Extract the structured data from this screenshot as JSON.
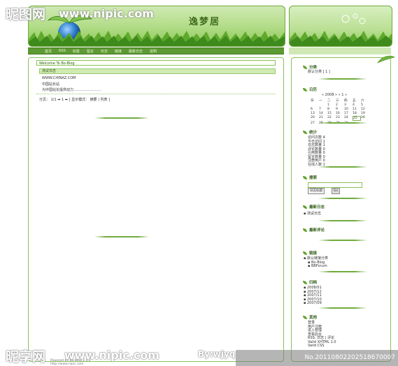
{
  "watermark": {
    "top_left": "昵图网",
    "top_url": "www.nipic.com",
    "bottom_left": "昵享网",
    "bottom_url": "www.nipic.com",
    "bottom_author": "By:wjyq",
    "id_text": "No.20110802202518670007"
  },
  "header": {
    "title": "逸梦居"
  },
  "nav": {
    "items": [
      "首页",
      "RSS",
      "标签",
      "留言",
      "日志",
      "链接",
      "最新日志",
      "说明"
    ]
  },
  "main": {
    "welcome": "Welcome To Bo-Blog",
    "post": {
      "title": "测试日志",
      "lines": [
        "WWW.CHINAZ.COM",
        "中国站长站",
        "为中国站长提供动力........................."
      ]
    },
    "pager": "分页： 1/1 ➡ 1 ➡ [ 显示模式： 摘要 | 列表 ]"
  },
  "sidebar": {
    "category": {
      "title": "分类",
      "items": [
        "默认分类 [ 1 ]"
      ]
    },
    "calendar": {
      "title": "日历",
      "header": "« 2008 » « 1 »",
      "weekdays": [
        "日",
        "一",
        "二",
        "三",
        "四",
        "五",
        "六"
      ],
      "days": [
        "",
        "",
        "1",
        "2",
        "3",
        "4",
        "5",
        "6",
        "7",
        "8",
        "9",
        "10",
        "11",
        "12",
        "13",
        "14",
        "15",
        "16",
        "17",
        "18",
        "19",
        "20",
        "21",
        "22",
        "23",
        "24",
        "25",
        "26",
        "27",
        "28",
        "29",
        "30",
        "31",
        "",
        ""
      ],
      "today": "25"
    },
    "stats": {
      "title": "统计",
      "items": [
        "访问次数 4",
        "今日访问 1",
        "日志数量 1",
        "评论数量 0",
        "引用数量 0",
        "留言数量 0",
        "注册用户 0",
        "在线人数 1"
      ]
    },
    "search": {
      "title": "搜索",
      "select_value": "日志标题",
      "go": "Go"
    },
    "latest_posts": {
      "title": "最新日志",
      "items": [
        "测试日志"
      ]
    },
    "latest_comments": {
      "title": "最新评论"
    },
    "links": {
      "title": "链接",
      "items": [
        "默认链接分类",
        "Bo-Blog",
        "BBForum"
      ]
    },
    "archive": {
      "title": "归档",
      "items": [
        "2008/01",
        "2007/12",
        "2007/11",
        "2007/10",
        "2007/09"
      ]
    },
    "about": {
      "title": "其他",
      "items": [
        "登录",
        "用户注册",
        "进入管理",
        "查看后台",
        "RSS: 日志 | 评论",
        "Valid XHTML 1.0",
        "Valid CSS"
      ]
    }
  },
  "footer": {
    "line1": "Powered by Bo-Blog 2.0.2",
    "line2": "http://www.nipic.com"
  },
  "colors": {
    "accent": "#5e9a33",
    "border": "#8ac25c",
    "light": "#cfeab2"
  }
}
